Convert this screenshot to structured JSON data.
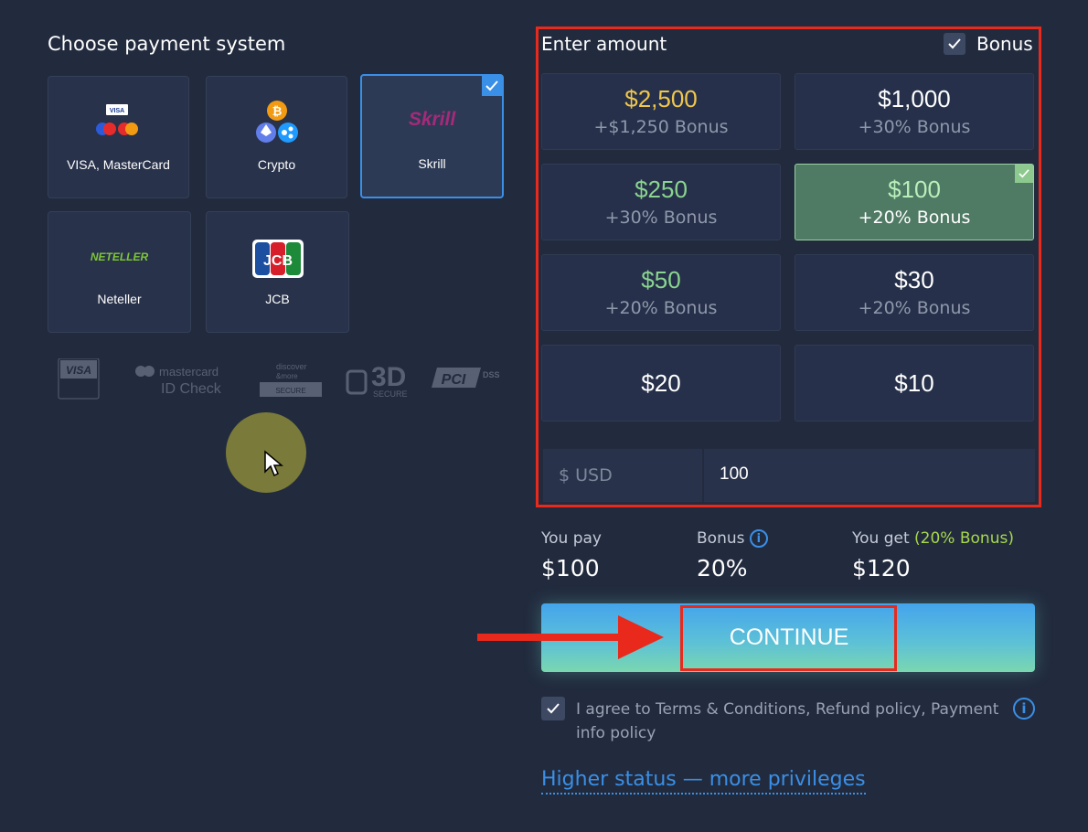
{
  "payment": {
    "title": "Choose payment system",
    "methods": [
      {
        "label": "VISA, MasterCard",
        "icon": "visa-mastercard-icon",
        "selected": false
      },
      {
        "label": "Crypto",
        "icon": "crypto-icon",
        "selected": false
      },
      {
        "label": "Skrill",
        "icon": "skrill-logo",
        "selected": true
      },
      {
        "label": "Neteller",
        "icon": "neteller-logo",
        "selected": false
      },
      {
        "label": "JCB",
        "icon": "jcb-logo",
        "selected": false
      }
    ],
    "logo_texts": {
      "skrill": "Skrill",
      "neteller": "NETELLER",
      "visa_small": "VISA",
      "jcb": "JCB"
    },
    "security_logos": {
      "visa": "VISA",
      "mastercard": "mastercard",
      "id_check": "ID Check",
      "dss_top": "discover",
      "dss_mid": "&more",
      "secure": "SECURE",
      "three_d": "3D",
      "three_d_sub": "SECURE",
      "pci": "PCI",
      "dss": "DSS"
    }
  },
  "amount": {
    "title": "Enter amount",
    "bonus_label": "Bonus",
    "bonus_checked": true,
    "options": [
      {
        "value": "$2,500",
        "bonus": "+$1,250 Bonus",
        "style": "gold"
      },
      {
        "value": "$1,000",
        "bonus": "+30% Bonus",
        "style": "white"
      },
      {
        "value": "$250",
        "bonus": "+30% Bonus",
        "style": "green"
      },
      {
        "value": "$100",
        "bonus": "+20% Bonus",
        "style": "selected"
      },
      {
        "value": "$50",
        "bonus": "+20% Bonus",
        "style": "green"
      },
      {
        "value": "$30",
        "bonus": "+20% Bonus",
        "style": "white"
      },
      {
        "value": "$20",
        "style": "white"
      },
      {
        "value": "$10",
        "style": "white"
      }
    ],
    "currency": "$ USD",
    "input_value": "100"
  },
  "summary": {
    "you_pay_label": "You pay",
    "you_pay": "$100",
    "bonus_label": "Bonus",
    "bonus": "20%",
    "you_get_label": "You get",
    "you_get_note": "(20% Bonus)",
    "you_get": "$120"
  },
  "continue_label": "CONTINUE",
  "terms": "I agree to Terms & Conditions, Refund policy, Payment info policy",
  "higher_status": "Higher status — more privileges",
  "colors": {
    "background": "#222b3e",
    "accent_blue": "#3a8fe6",
    "highlight_red": "#e8291c",
    "gold": "#f0c74d",
    "green": "#8ad48f",
    "bonus_note": "#a7d84b"
  }
}
